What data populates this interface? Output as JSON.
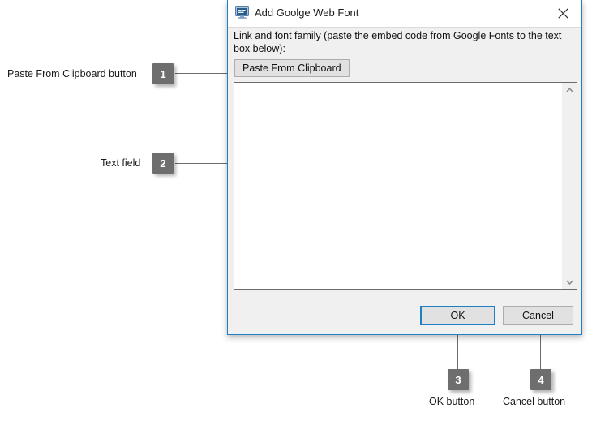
{
  "dialog": {
    "title": "Add Goolge Web Font",
    "title_icon": "monitor-icon",
    "close_icon": "close-icon",
    "description": "Link and font family (paste the embed code from Google Fonts to the text box below):",
    "paste_button": "Paste From Clipboard",
    "textarea_value": "",
    "textarea_placeholder": "",
    "scrollbar": {
      "up_icon": "chevron-up-icon",
      "down_icon": "chevron-down-icon"
    },
    "ok_button": "OK",
    "cancel_button": "Cancel"
  },
  "annotations": [
    {
      "number": "1",
      "label": "Paste From Clipboard button"
    },
    {
      "number": "2",
      "label": "Text field"
    },
    {
      "number": "3",
      "label": "OK button"
    },
    {
      "number": "4",
      "label": "Cancel button"
    }
  ],
  "colors": {
    "accent": "#1f7fc4",
    "badge": "#6e6e6e",
    "dialog_bg": "#f0f0f0",
    "leader": "#6b6b6b"
  }
}
